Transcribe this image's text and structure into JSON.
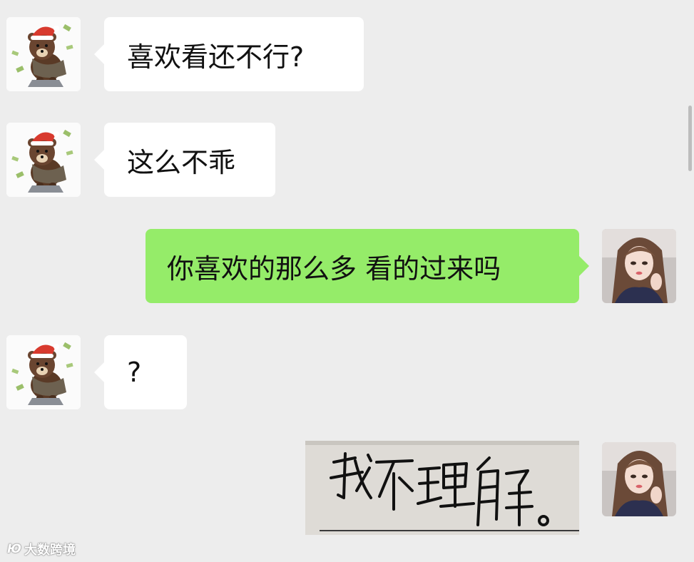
{
  "messages": [
    {
      "side": "left",
      "text": "喜欢看还不行?"
    },
    {
      "side": "left",
      "text": "这么不乖"
    },
    {
      "side": "right",
      "text": "你喜欢的那么多 看的过来吗"
    },
    {
      "side": "left",
      "text": "?"
    },
    {
      "side": "right",
      "type": "image",
      "handwriting": "我不理解。"
    }
  ],
  "watermark": {
    "logo": "Ю",
    "text": "大数跨境"
  },
  "colors": {
    "background": "#ededed",
    "bubble_in": "#ffffff",
    "bubble_out": "#95ec69"
  },
  "icons": {
    "left_avatar": "brown-bear-santa-hat-avatar",
    "right_avatar": "girl-portrait-avatar"
  }
}
